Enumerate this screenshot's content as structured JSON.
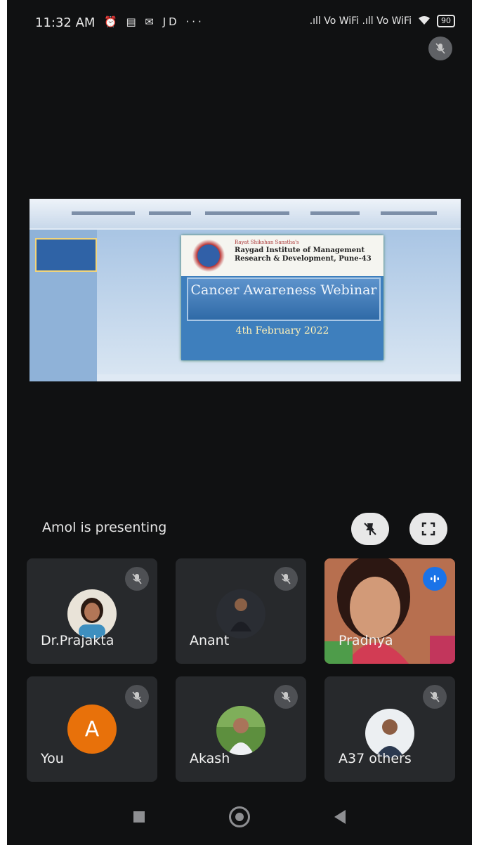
{
  "status_bar": {
    "time": "11:32 AM",
    "left_icons": "⏰ ▤ ✉ JD ···",
    "signal": ".ıll Vo WiFi .ıll Vo WiFi",
    "battery": "90"
  },
  "presentation": {
    "institution_top": "Rayat Shikshan Sanstha's",
    "institution_name": "Raygad Institute of Management Research & Development, Pune-43",
    "slide_title": "Cancer Awareness Webinar",
    "slide_date": "4th February 2022"
  },
  "presenting_text": "Amol is presenting",
  "participants": [
    {
      "name": "Dr.Prajakta",
      "muted": true
    },
    {
      "name": "Anant",
      "muted": true
    },
    {
      "name": "Pradnya",
      "muted": false,
      "speaking": true
    },
    {
      "name": "You",
      "initial": "A",
      "muted": true
    },
    {
      "name": "Akash",
      "muted": true
    },
    {
      "name": "A",
      "others_label": "37 others",
      "muted": true
    }
  ],
  "icons": {
    "mic_off": "mic-off-icon",
    "pin": "pin-icon",
    "fullscreen": "fullscreen-icon",
    "speaking": "speaking-icon"
  },
  "colors": {
    "background": "#101112",
    "tile": "#27292c",
    "avatar_orange": "#e8710a",
    "speaking_blue": "#1a73e8"
  }
}
